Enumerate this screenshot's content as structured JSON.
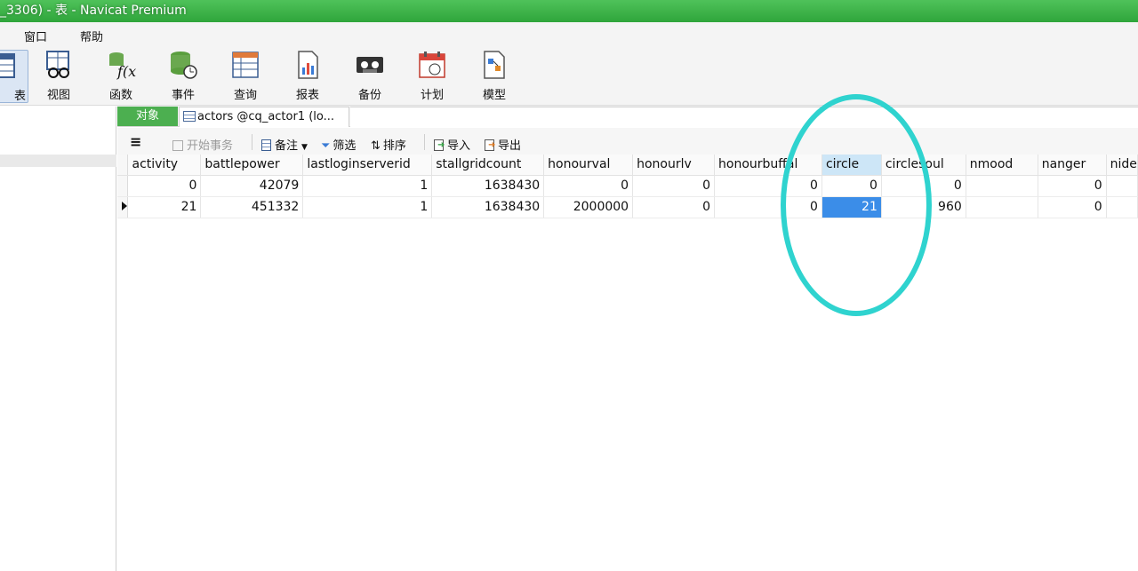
{
  "window": {
    "title": "_3306) - 表 - Navicat Premium"
  },
  "menu": [
    "窗口",
    "帮助"
  ],
  "toolbar": {
    "partial_label": "表",
    "tools": [
      {
        "label": "视图",
        "icon": "view-icon"
      },
      {
        "label": "函数",
        "icon": "function-icon"
      },
      {
        "label": "事件",
        "icon": "event-icon"
      },
      {
        "label": "查询",
        "icon": "query-icon"
      },
      {
        "label": "报表",
        "icon": "report-icon"
      },
      {
        "label": "备份",
        "icon": "backup-icon"
      },
      {
        "label": "计划",
        "icon": "schedule-icon"
      },
      {
        "label": "模型",
        "icon": "model-icon"
      }
    ]
  },
  "tabs": {
    "object_label": "对象",
    "table_tab_label": "actors @cq_actor1 (lo..."
  },
  "subtoolbar": {
    "menu_icon": "≡",
    "begin_transaction": "开始事务",
    "memo": "备注",
    "filter": "筛选",
    "sort": "排序",
    "import": "导入",
    "export": "导出"
  },
  "grid": {
    "columns": [
      "activity",
      "battlepower",
      "lastloginserverid",
      "stallgridcount",
      "honourval",
      "honourlv",
      "honourbuffal",
      "circle",
      "circlesoul",
      "nmood",
      "nanger",
      "nide"
    ],
    "rows": [
      [
        "0",
        "42079",
        "1",
        "1638430",
        "0",
        "0",
        "0",
        "0",
        "0",
        "",
        "0",
        ""
      ],
      [
        "21",
        "451332",
        "1",
        "1638430",
        "2000000",
        "0",
        "0",
        "21",
        "960",
        "",
        "0",
        ""
      ]
    ],
    "selected_column": "circle",
    "selected_row": 1
  },
  "colors": {
    "title_green": "#2fa53b",
    "object_tab_green": "#4caf50",
    "selection_blue": "#3b8de8",
    "annotation_cyan": "#2fd3cf"
  }
}
